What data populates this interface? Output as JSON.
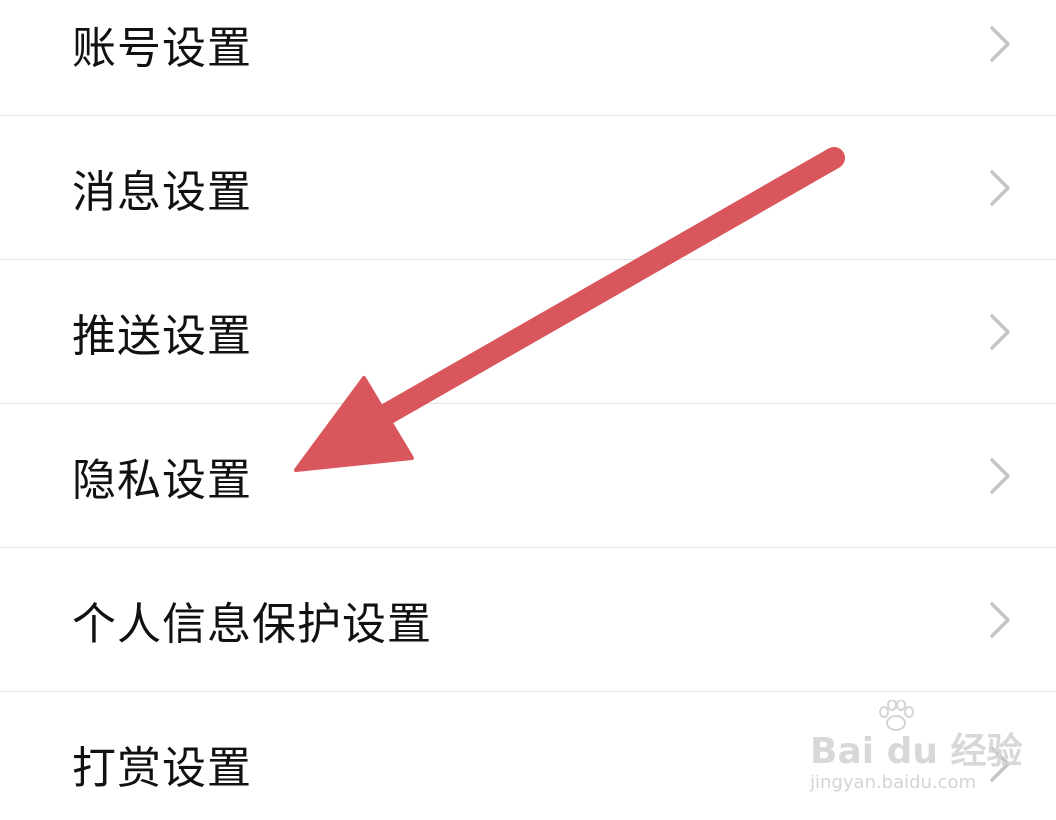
{
  "settings": {
    "items": [
      {
        "label": "账号设置"
      },
      {
        "label": "消息设置"
      },
      {
        "label": "推送设置"
      },
      {
        "label": "隐私设置"
      },
      {
        "label": "个人信息保护设置"
      },
      {
        "label": "打赏设置"
      }
    ]
  },
  "watermark": {
    "logo_text": "Bai du 经验",
    "url": "jingyan.baidu.com"
  },
  "colors": {
    "arrow": "#d9575c",
    "divider": "#e3e3e3",
    "chevron": "#c4c4c4",
    "text": "#111111"
  },
  "icons": {
    "chevron": "chevron-right-icon",
    "annotation": "red-arrow-annotation"
  }
}
